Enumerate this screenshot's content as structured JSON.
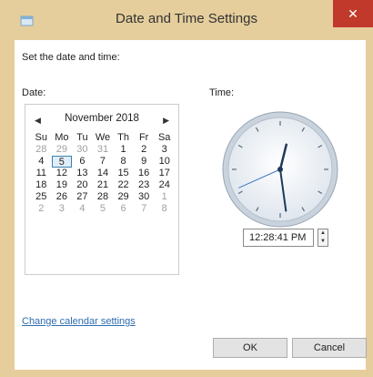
{
  "window": {
    "title": "Date and Time Settings",
    "close_glyph": "✕"
  },
  "heading": "Set the date and time:",
  "date_label": "Date:",
  "time_label": "Time:",
  "calendar": {
    "month": "November 2018",
    "prev_glyph": "◀",
    "next_glyph": "▶",
    "weekdays": [
      "Su",
      "Mo",
      "Tu",
      "We",
      "Th",
      "Fr",
      "Sa"
    ],
    "selected_day": "5",
    "weeks": [
      [
        {
          "d": "28",
          "o": true
        },
        {
          "d": "29",
          "o": true
        },
        {
          "d": "30",
          "o": true
        },
        {
          "d": "31",
          "o": true
        },
        {
          "d": "1"
        },
        {
          "d": "2"
        },
        {
          "d": "3"
        }
      ],
      [
        {
          "d": "4"
        },
        {
          "d": "5",
          "s": true
        },
        {
          "d": "6"
        },
        {
          "d": "7"
        },
        {
          "d": "8"
        },
        {
          "d": "9"
        },
        {
          "d": "10"
        }
      ],
      [
        {
          "d": "11"
        },
        {
          "d": "12"
        },
        {
          "d": "13"
        },
        {
          "d": "14"
        },
        {
          "d": "15"
        },
        {
          "d": "16"
        },
        {
          "d": "17"
        }
      ],
      [
        {
          "d": "18"
        },
        {
          "d": "19"
        },
        {
          "d": "20"
        },
        {
          "d": "21"
        },
        {
          "d": "22"
        },
        {
          "d": "23"
        },
        {
          "d": "24"
        }
      ],
      [
        {
          "d": "25"
        },
        {
          "d": "26"
        },
        {
          "d": "27"
        },
        {
          "d": "28"
        },
        {
          "d": "29"
        },
        {
          "d": "30"
        },
        {
          "d": "1",
          "o": true
        }
      ],
      [
        {
          "d": "2",
          "o": true
        },
        {
          "d": "3",
          "o": true
        },
        {
          "d": "4",
          "o": true
        },
        {
          "d": "5",
          "o": true
        },
        {
          "d": "6",
          "o": true
        },
        {
          "d": "7",
          "o": true
        },
        {
          "d": "8",
          "o": true
        }
      ]
    ]
  },
  "clock": {
    "hour": 12,
    "minute": 28,
    "second": 41
  },
  "time_value": "12:28:41 PM",
  "spinner": {
    "up_glyph": "▲",
    "down_glyph": "▼"
  },
  "link": "Change calendar settings",
  "buttons": {
    "ok": "OK",
    "cancel": "Cancel"
  },
  "colors": {
    "frame": "#e5ce9c",
    "close": "#c0392b",
    "link": "#2f6db0",
    "selection": "#3c7fb1"
  }
}
